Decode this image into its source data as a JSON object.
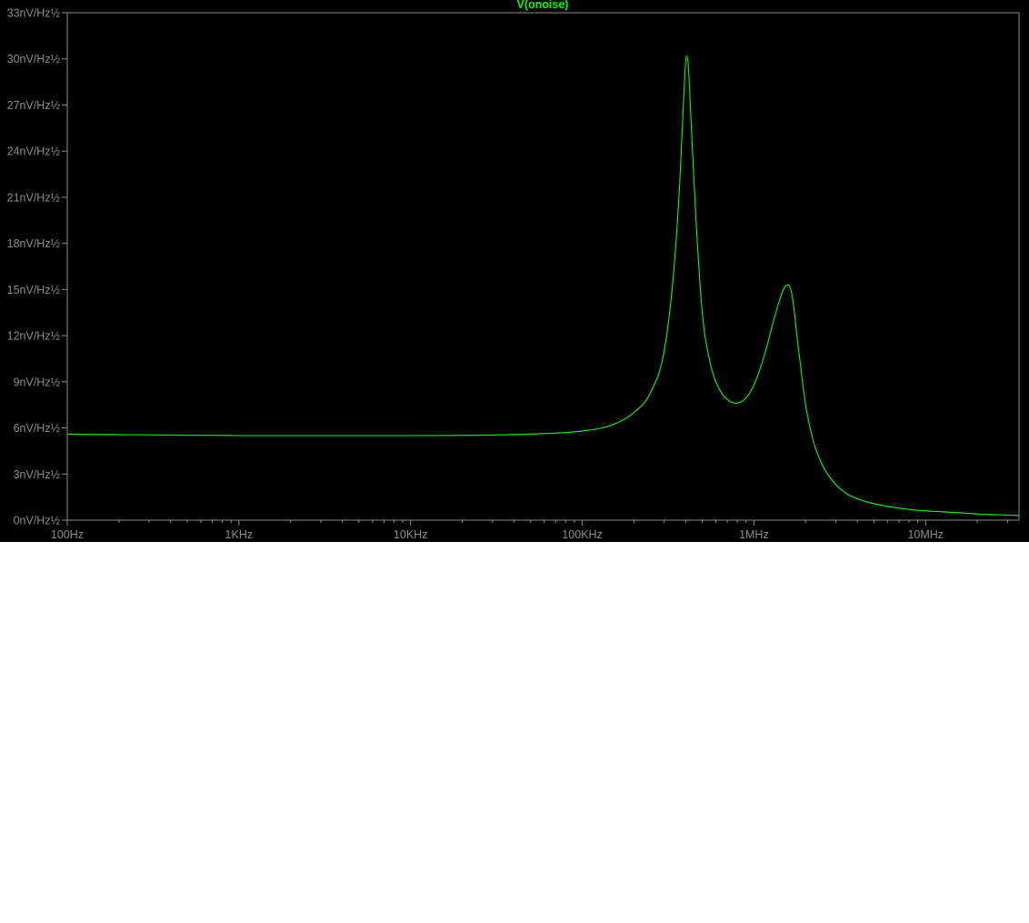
{
  "chart_data": {
    "type": "line",
    "title": "V(onoise)",
    "x_scale": "log",
    "xlim": [
      100,
      35000000
    ],
    "ylim": [
      0,
      33
    ],
    "x_ticks": [
      {
        "value": 100,
        "label": "100Hz"
      },
      {
        "value": 1000,
        "label": "1KHz"
      },
      {
        "value": 10000,
        "label": "10KHz"
      },
      {
        "value": 100000,
        "label": "100KHz"
      },
      {
        "value": 1000000,
        "label": "1MHz"
      },
      {
        "value": 10000000,
        "label": "10MHz"
      }
    ],
    "y_ticks": [
      {
        "value": 0,
        "label": "0nV/Hz½"
      },
      {
        "value": 3,
        "label": "3nV/Hz½"
      },
      {
        "value": 6,
        "label": "6nV/Hz½"
      },
      {
        "value": 9,
        "label": "9nV/Hz½"
      },
      {
        "value": 12,
        "label": "12nV/Hz½"
      },
      {
        "value": 15,
        "label": "15nV/Hz½"
      },
      {
        "value": 18,
        "label": "18nV/Hz½"
      },
      {
        "value": 21,
        "label": "21nV/Hz½"
      },
      {
        "value": 24,
        "label": "24nV/Hz½"
      },
      {
        "value": 27,
        "label": "27nV/Hz½"
      },
      {
        "value": 30,
        "label": "30nV/Hz½"
      },
      {
        "value": 33,
        "label": "33nV/Hz½"
      }
    ],
    "series": [
      {
        "name": "V(onoise)",
        "color": "#00ff00",
        "x": [
          100,
          1000,
          10000,
          50000,
          100000,
          150000,
          200000,
          250000,
          300000,
          340000,
          370000,
          390000,
          405000,
          415000,
          430000,
          460000,
          500000,
          560000,
          630000,
          710000,
          780000,
          870000,
          960000,
          1060000,
          1170000,
          1290000,
          1400000,
          1500000,
          1580000,
          1640000,
          1700000,
          1780000,
          1880000,
          2000000,
          2200000,
          2500000,
          2900000,
          3500000,
          4500000,
          6000000,
          8000000,
          10000000,
          15000000,
          20000000,
          27000000,
          35000000
        ],
        "y": [
          5.6,
          5.5,
          5.5,
          5.6,
          5.8,
          6.2,
          7.0,
          8.3,
          11.0,
          16.0,
          22.0,
          27.5,
          30.2,
          29.5,
          26.0,
          19.5,
          13.5,
          10.1,
          8.5,
          7.8,
          7.6,
          7.8,
          8.4,
          9.5,
          11.0,
          12.8,
          14.2,
          15.1,
          15.3,
          15.0,
          14.0,
          12.0,
          9.8,
          7.5,
          5.3,
          3.6,
          2.5,
          1.7,
          1.2,
          0.9,
          0.7,
          0.6,
          0.5,
          0.4,
          0.35,
          0.3
        ]
      }
    ]
  }
}
